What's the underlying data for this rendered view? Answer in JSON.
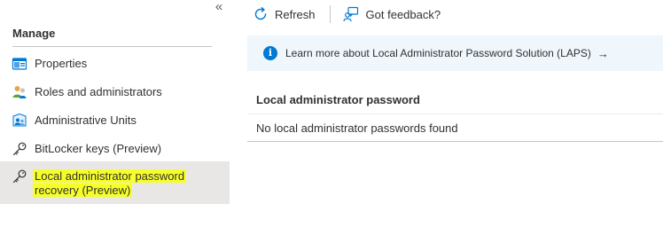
{
  "sidebar": {
    "collapse_icon": "double-chevron-left-icon",
    "section_title": "Manage",
    "items": [
      {
        "label": "Properties",
        "icon": "properties-icon"
      },
      {
        "label": "Roles and administrators",
        "icon": "roles-users-icon"
      },
      {
        "label": "Administrative Units",
        "icon": "admin-units-icon"
      },
      {
        "label": "BitLocker keys (Preview)",
        "icon": "key-icon"
      },
      {
        "label_line1": "Local administrator password",
        "label_line2": "recovery (Preview)",
        "icon": "key-icon",
        "selected": true
      }
    ]
  },
  "toolbar": {
    "refresh_label": "Refresh",
    "feedback_label": "Got feedback?"
  },
  "info": {
    "text": "Learn more about Local Administrator Password Solution (LAPS)",
    "arrow": "→"
  },
  "table": {
    "header": "Local administrator password",
    "empty_text": "No local administrator passwords found"
  },
  "colors": {
    "accent": "#0078d4",
    "highlight": "#f7ff28",
    "info_background": "#eff6fc",
    "selected_background": "#e8e7e6"
  }
}
